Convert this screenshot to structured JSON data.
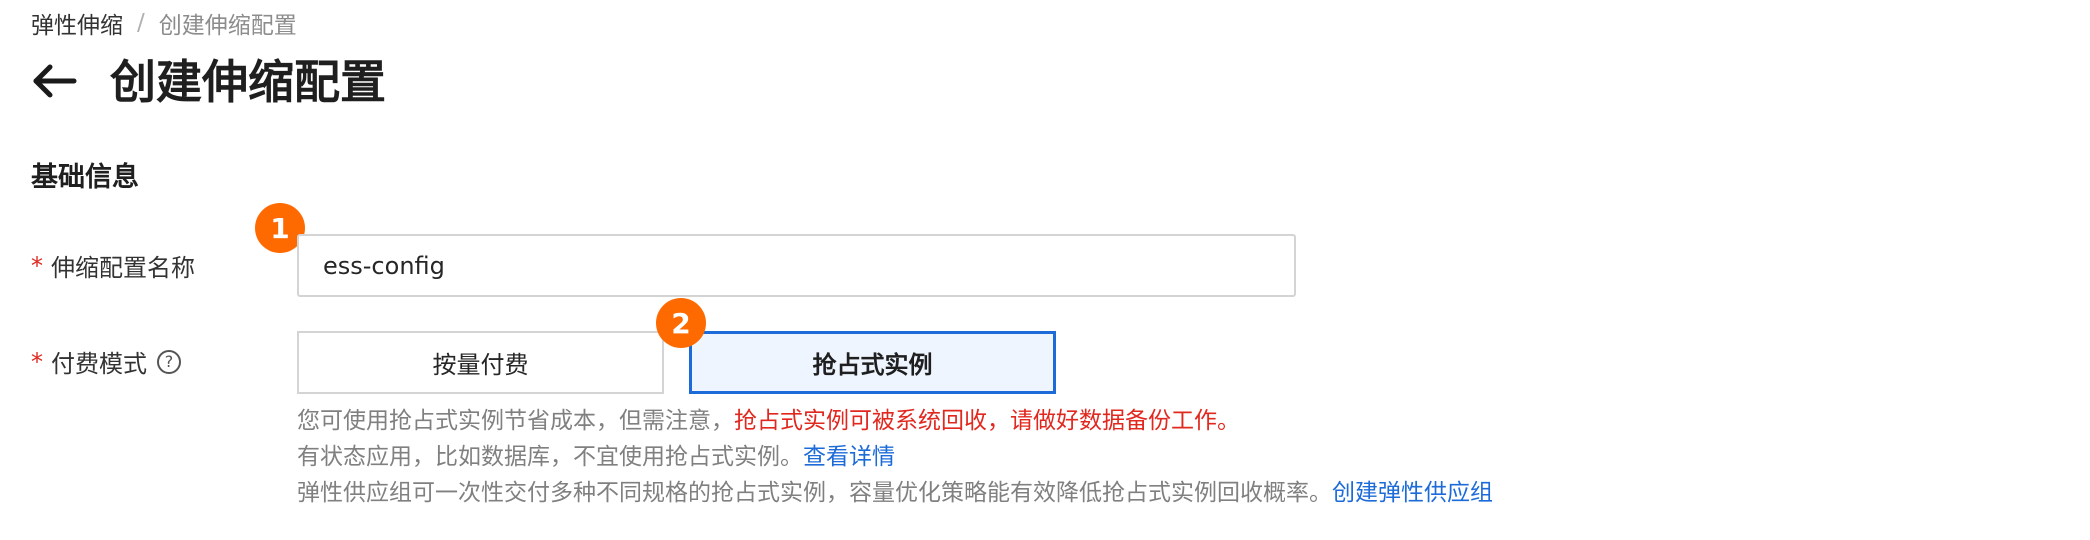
{
  "breadcrumb": {
    "root": "弹性伸缩",
    "separator": "/",
    "current": "创建伸缩配置"
  },
  "header": {
    "back_icon": "arrow-left-icon",
    "title": "创建伸缩配置"
  },
  "section": {
    "title": "基础信息"
  },
  "form": {
    "required_mark": "*",
    "name_field": {
      "label": "伸缩配置名称",
      "value": "ess-config",
      "badge": "1"
    },
    "payment": {
      "label": "付费模式",
      "help_icon": "question-circle-icon",
      "help_glyph": "?",
      "badge": "2",
      "options": [
        {
          "label": "按量付费",
          "selected": false
        },
        {
          "label": "抢占式实例",
          "selected": true
        }
      ]
    },
    "hints": {
      "line1_normal": "您可使用抢占式实例节省成本，但需注意，",
      "line1_warning": "抢占式实例可被系统回收，请做好数据备份工作。",
      "line2_normal": "有状态应用，比如数据库，不宜使用抢占式实例。",
      "line2_link": "查看详情",
      "line3_normal": "弹性供应组可一次性交付多种不同规格的抢占式实例，容量优化策略能有效降低抢占式实例回收概率。",
      "line3_link": "创建弹性供应组"
    }
  },
  "colors": {
    "accent_blue": "#1c6bd8",
    "warning_red": "#e0281f",
    "badge_orange": "#ff6a00"
  }
}
